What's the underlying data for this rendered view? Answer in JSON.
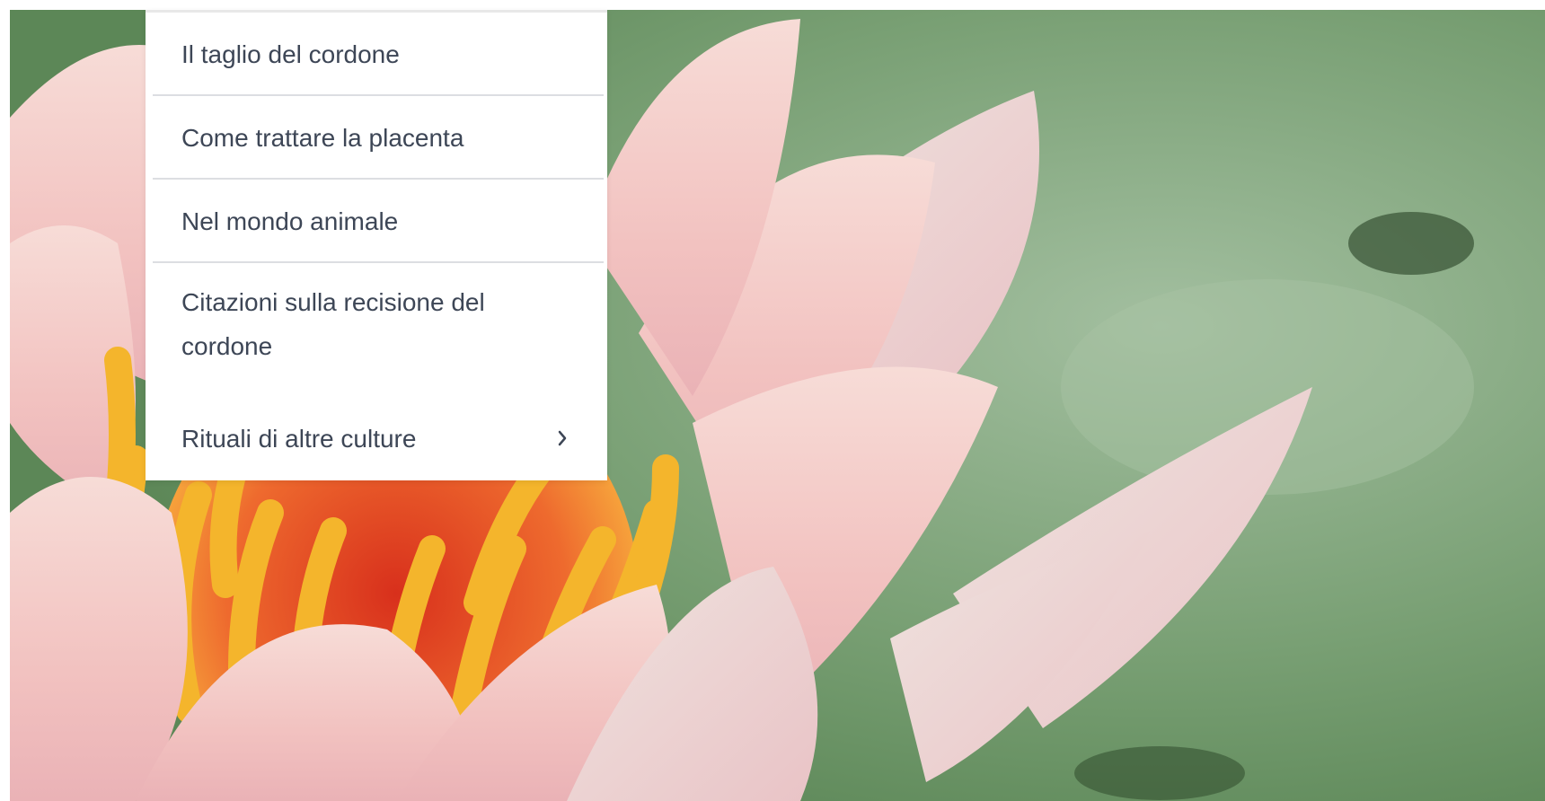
{
  "menu": {
    "items": [
      {
        "label": "Il taglio del cordone"
      },
      {
        "label": "Come trattare la placenta"
      },
      {
        "label": "Nel mondo animale"
      },
      {
        "label": "Citazioni sulla recisione del cordone"
      },
      {
        "label": "Rituali di altre culture",
        "icon": "chevron-right-icon"
      }
    ]
  },
  "colors": {
    "menu_text": "#3d4656",
    "menu_background": "#ffffff",
    "divider": "#dcdee2",
    "background_green": "#7fa67a",
    "petal_pink": "#f3c7c4",
    "stamen_yellow": "#f4b52c",
    "center_red": "#e54a2a"
  }
}
